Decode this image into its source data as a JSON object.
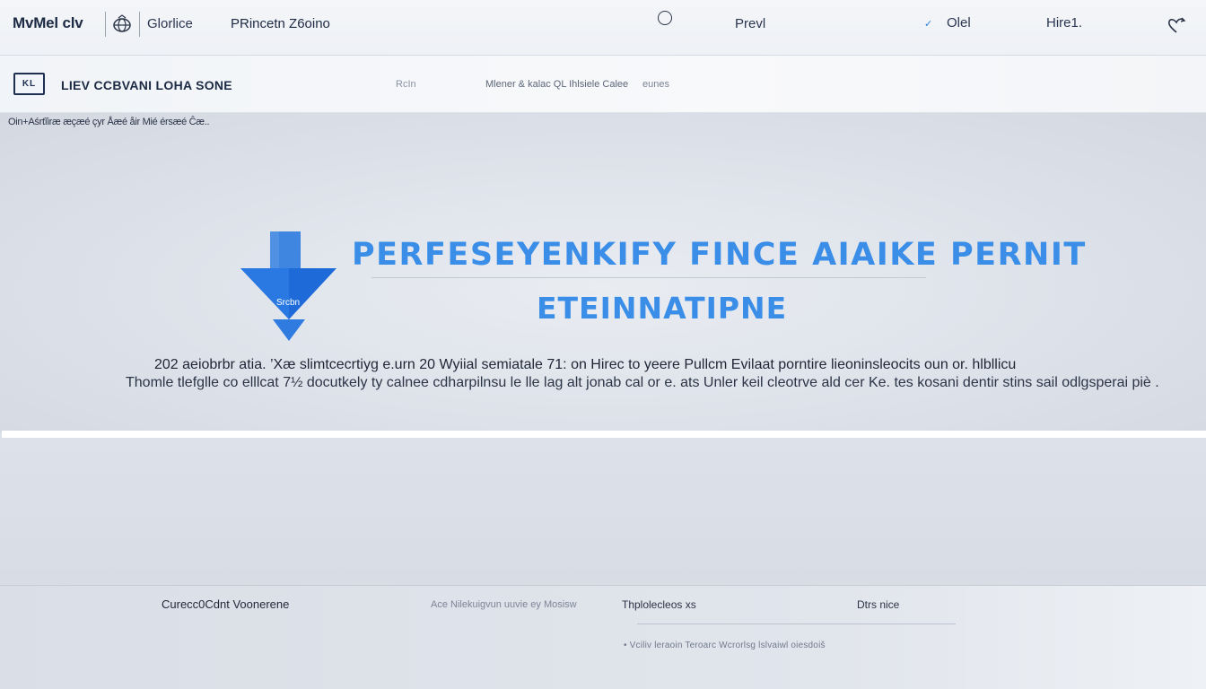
{
  "nav": {
    "brand": "MvMel clv",
    "services": "Glorlice",
    "product": "PRincetn Z6oino",
    "prev": "Prevl",
    "olel": "Olel",
    "hire": "Hire1."
  },
  "subbar": {
    "logo_text": "KL",
    "title": "LIEV CCBVANI LOHA SONE",
    "link_a": "RcIn",
    "link_b": "Mlener & kalac QL Ihlsiele Calee",
    "link_c": "eunes"
  },
  "breadcrumb": "Oin+Aśrtĩiræ æçæé çyr Åæé åir Mié érsæé Ĉæ..",
  "hero": {
    "logo_label": "Srcbn",
    "title": "PERFESEYENKIFY FINCE AIAIKE PERNIT",
    "subtitle": "ETEINNATIPNE",
    "line1": "202 aeiobrbr atia.       ’Xæ slimtcecrtiyg e.urn 20 Wyiial semiatale 71: on Hirec to yeere Pullcm Evilaat porntire lieoninsleocits oun or. hlbllicu",
    "line2": "Thomle tlefglle co elllcat 7½ docutkely ty calnee cdharpilnsu le lle lag alt jonab cal or e. ats Unler keil cleotrve ald cer Ke. tes kosani dentir stins sail odlgsperai piè ."
  },
  "footer": {
    "col_a": "Curecc0Cdnt Voonerene",
    "col_b": "Ace Nilekuigvun uuvie ey Mosisw",
    "col_c": "Thplolecleos xs",
    "col_d": "Dtrs nice",
    "links": "• Vciliv   leraoin   Teroarc   Wcrorlsg    lslvaiwl   oiesdoiš"
  },
  "colors": {
    "accent": "#3b8ee8",
    "logo_blue": "#1d6ad8",
    "navy": "#1d2a44"
  },
  "icons": [
    "globe-icon",
    "circle-icon",
    "check-icon",
    "heart-icon",
    "arrow-down-logo"
  ]
}
